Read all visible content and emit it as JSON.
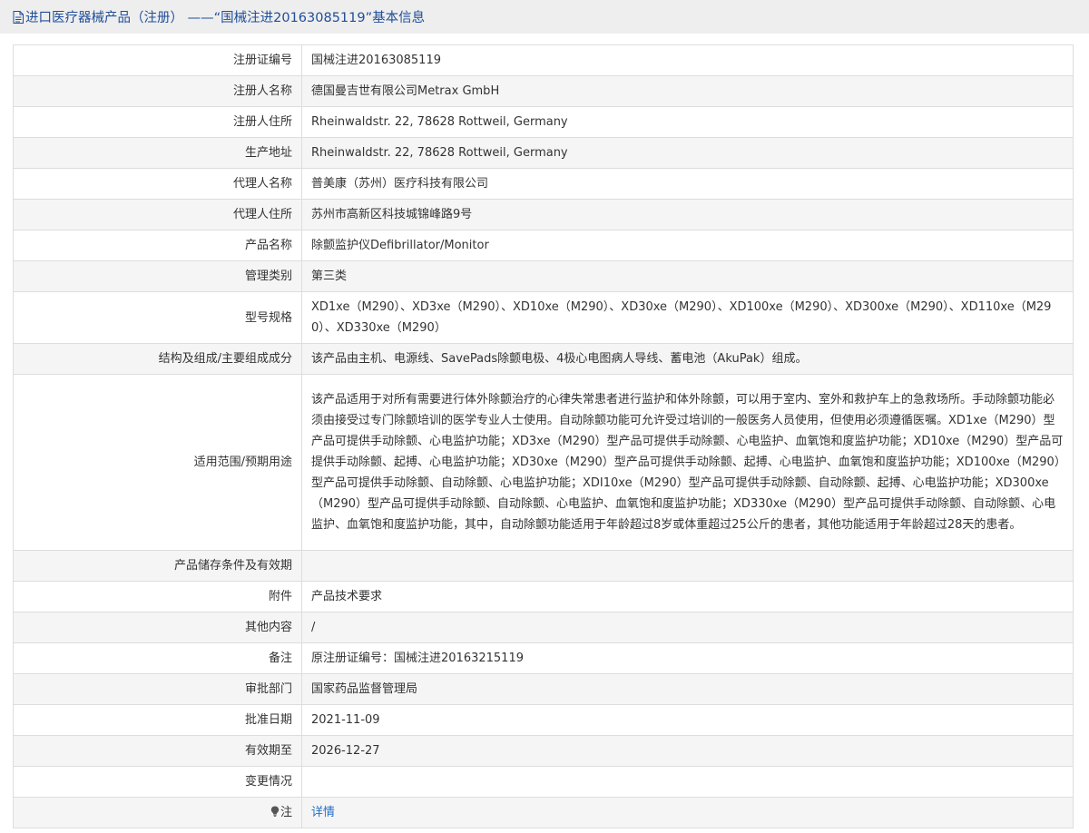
{
  "header": {
    "title": "进口医疗器械产品（注册） ——“国械注进20163085119”基本信息"
  },
  "rows": [
    {
      "label": "注册证编号",
      "value": "国械注进20163085119"
    },
    {
      "label": "注册人名称",
      "value": "德国曼吉世有限公司Metrax GmbH"
    },
    {
      "label": "注册人住所",
      "value": "Rheinwaldstr. 22, 78628 Rottweil, Germany"
    },
    {
      "label": "生产地址",
      "value": "Rheinwaldstr. 22, 78628 Rottweil, Germany"
    },
    {
      "label": "代理人名称",
      "value": "普美康（苏州）医疗科技有限公司"
    },
    {
      "label": "代理人住所",
      "value": "苏州市高新区科技城锦峰路9号"
    },
    {
      "label": "产品名称",
      "value": "除颤监护仪Defibrillator/Monitor"
    },
    {
      "label": "管理类别",
      "value": "第三类"
    },
    {
      "label": "型号规格",
      "value": "XD1xe（M290）、XD3xe（M290）、XD10xe（M290）、XD30xe（M290）、XD100xe（M290）、XD300xe（M290）、XD110xe（M290）、XD330xe（M290）"
    },
    {
      "label": "结构及组成/主要组成成分",
      "value": "该产品由主机、电源线、SavePads除颤电极、4极心电图病人导线、蓄电池（AkuPak）组成。"
    },
    {
      "label": "适用范围/预期用途",
      "value": "该产品适用于对所有需要进行体外除颤治疗的心律失常患者进行监护和体外除颤，可以用于室内、室外和救护车上的急救场所。手动除颤功能必须由接受过专门除颤培训的医学专业人士使用。自动除颤功能可允许受过培训的一般医务人员使用，但使用必须遵循医嘱。XD1xe（M290）型产品可提供手动除颤、心电监护功能；XD3xe（M290）型产品可提供手动除颤、心电监护、血氧饱和度监护功能；XD10xe（M290）型产品可提供手动除颤、起搏、心电监护功能；XD30xe（M290）型产品可提供手动除颤、起搏、心电监护、血氧饱和度监护功能；XD100xe（M290）型产品可提供手动除颤、自动除颤、心电监护功能；XDI10xe（M290）型产品可提供手动除颤、自动除颤、起搏、心电监护功能；XD300xe（M290）型产品可提供手动除颤、自动除颤、心电监护、血氧饱和度监护功能；XD330xe（M290）型产品可提供手动除颤、自动除颤、心电监护、血氧饱和度监护功能，其中，自动除颤功能适用于年龄超过8岁或体重超过25公斤的患者，其他功能适用于年龄超过28天的患者。"
    },
    {
      "label": "产品储存条件及有效期",
      "value": ""
    },
    {
      "label": "附件",
      "value": "产品技术要求"
    },
    {
      "label": "其他内容",
      "value": "/"
    },
    {
      "label": "备注",
      "value": "原注册证编号：国械注进20163215119"
    },
    {
      "label": "审批部门",
      "value": "国家药品监督管理局"
    },
    {
      "label": "批准日期",
      "value": "2021-11-09"
    },
    {
      "label": "有效期至",
      "value": "2026-12-27"
    },
    {
      "label": "变更情况",
      "value": ""
    }
  ],
  "note": {
    "label": "注",
    "link_text": "详情",
    "icon": "lightbulb-icon"
  },
  "colors": {
    "title_text": "#1f4e9a",
    "link": "#1f6fc8",
    "border": "#dddddd",
    "row_alt": "#f5f5f5",
    "title_bg": "#eeeeee"
  }
}
